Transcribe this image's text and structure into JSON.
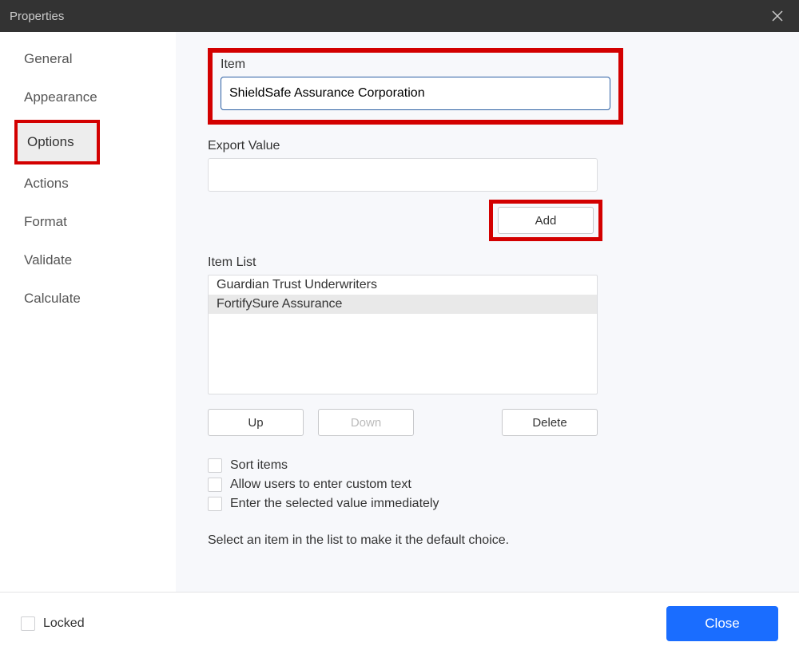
{
  "titlebar": {
    "title": "Properties"
  },
  "sidebar": {
    "tabs": [
      {
        "label": "General"
      },
      {
        "label": "Appearance"
      },
      {
        "label": "Options"
      },
      {
        "label": "Actions"
      },
      {
        "label": "Format"
      },
      {
        "label": "Validate"
      },
      {
        "label": "Calculate"
      }
    ],
    "active_index": 2
  },
  "form": {
    "item_label": "Item",
    "item_value": "ShieldSafe Assurance Corporation",
    "export_label": "Export Value",
    "export_value": "",
    "add_label": "Add",
    "list_label": "Item List",
    "list_items": [
      "Guardian Trust Underwriters",
      "FortifySure Assurance"
    ],
    "btn_up": "Up",
    "btn_down": "Down",
    "btn_delete": "Delete",
    "chk_sort": "Sort items",
    "chk_custom": "Allow users to enter custom text",
    "chk_immediate": "Enter the selected value immediately",
    "hint": "Select an item in the list to make it the default choice."
  },
  "footer": {
    "locked_label": "Locked",
    "close_label": "Close"
  }
}
